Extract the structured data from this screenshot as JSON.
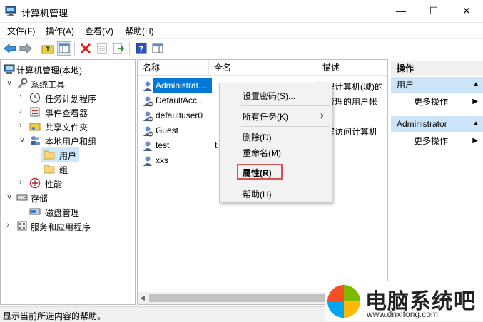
{
  "window": {
    "title": "计算机管理",
    "minimize": "—",
    "maximize": "☐",
    "close": "✕"
  },
  "menubar": [
    "文件(F)",
    "操作(A)",
    "查看(V)",
    "帮助(H)"
  ],
  "tree": [
    {
      "label": "计算机管理(本地)",
      "level": 0,
      "expander": ""
    },
    {
      "label": "系统工具",
      "level": 1,
      "expander": "∨"
    },
    {
      "label": "任务计划程序",
      "level": 2,
      "expander": "›"
    },
    {
      "label": "事件查看器",
      "level": 2,
      "expander": "›"
    },
    {
      "label": "共享文件夹",
      "level": 2,
      "expander": "›"
    },
    {
      "label": "本地用户和组",
      "level": 2,
      "expander": "∨"
    },
    {
      "label": "用户",
      "level": 3,
      "expander": ""
    },
    {
      "label": "组",
      "level": 3,
      "expander": ""
    },
    {
      "label": "性能",
      "level": 2,
      "expander": "›"
    },
    {
      "label": "存储",
      "level": 1,
      "expander": "∨"
    },
    {
      "label": "磁盘管理",
      "level": 2,
      "expander": ""
    },
    {
      "label": "服务和应用程序",
      "level": 1,
      "expander": "›"
    }
  ],
  "list": {
    "columns": [
      "名称",
      "全名",
      "描述"
    ],
    "rows": [
      {
        "name": "Administrat...",
        "full": "",
        "desc": "管理计算机(域)的"
      },
      {
        "name": "DefaultAcc...",
        "full": "",
        "desc": "统管理的用户帐"
      },
      {
        "name": "defaultuser0",
        "full": "",
        "desc": ""
      },
      {
        "name": "Guest",
        "full": "",
        "desc": "来宾访问计算机"
      },
      {
        "name": "test",
        "full": "t",
        "desc": ""
      },
      {
        "name": "xxs",
        "full": "",
        "desc": ""
      }
    ]
  },
  "context_menu": {
    "items": [
      {
        "label": "设置密码(S)...",
        "arrow": ""
      },
      {
        "label": "所有任务(K)",
        "arrow": "›"
      },
      {
        "label": "删除(D)",
        "arrow": ""
      },
      {
        "label": "重命名(M)",
        "arrow": ""
      },
      {
        "label": "属性(R)",
        "arrow": ""
      },
      {
        "label": "帮助(H)",
        "arrow": ""
      }
    ]
  },
  "actions": {
    "header": "操作",
    "groups": [
      {
        "title": "用户",
        "item": "更多操作"
      },
      {
        "title": "Administrator",
        "item": "更多操作"
      }
    ]
  },
  "statusbar": {
    "text": "显示当前所选内容的帮助。"
  },
  "watermark": {
    "brand": "电脑系统吧",
    "url": "www.dnxitong.com"
  },
  "colors": {
    "selection": "#cce8ff",
    "action_head": "#cce4f7",
    "highlight_box": "#d9534f"
  }
}
